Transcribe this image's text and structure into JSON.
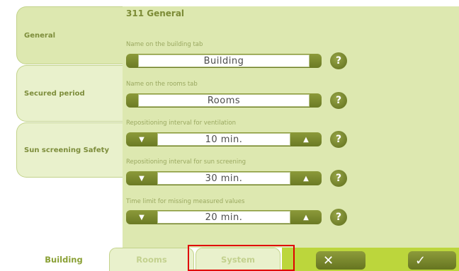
{
  "sidebar": {
    "items": [
      {
        "label": "General",
        "active": true
      },
      {
        "label": "Secured period",
        "active": false
      },
      {
        "label": "Sun screening Safety",
        "active": false
      }
    ]
  },
  "main": {
    "title": "311 General",
    "fields": [
      {
        "label": "Name on the building tab",
        "value": "Building",
        "type": "text"
      },
      {
        "label": "Name on the rooms tab",
        "value": "Rooms",
        "type": "text"
      },
      {
        "label": "Repositioning interval for ventilation",
        "value": "10 min.",
        "type": "stepper"
      },
      {
        "label": "Repositioning interval for sun screening",
        "value": "30 min.",
        "type": "stepper"
      },
      {
        "label": "Time limit for missing measured values",
        "value": "20 min.",
        "type": "stepper"
      }
    ],
    "help_symbol": "?"
  },
  "icons": {
    "decrease": "triangle-down-icon",
    "increase": "triangle-up-icon",
    "help": "question-icon",
    "cancel": "close-icon",
    "confirm": "check-icon"
  },
  "bottom_tabs": [
    {
      "label": "Building",
      "active": true
    },
    {
      "label": "Rooms",
      "active": false
    },
    {
      "label": "System",
      "active": false
    }
  ],
  "actions": {
    "cancel_symbol": "✕",
    "confirm_symbol": "✓"
  },
  "colors": {
    "accent": "#bcd63c",
    "panel": "#dde8b0",
    "button": "#7b8a2e",
    "highlight": "#e00000"
  }
}
